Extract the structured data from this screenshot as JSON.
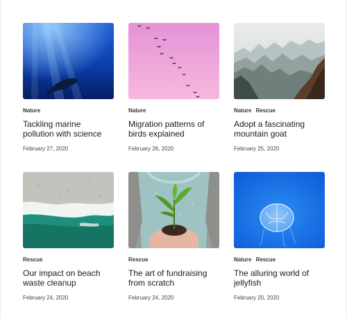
{
  "cards": [
    {
      "tags": [
        "Nature"
      ],
      "title": "Tackling marine pollution with science",
      "date": "February 27, 2020",
      "image": "whale-underwater-photo"
    },
    {
      "tags": [
        "Nature"
      ],
      "title": "Migration patterns of birds explained",
      "date": "February 26, 2020",
      "image": "birds-pink-sky-photo"
    },
    {
      "tags": [
        "Nature",
        "Rescue"
      ],
      "title": "Adopt a fascinating mountain goat",
      "date": "February 25, 2020",
      "image": "mountain-ridges-photo"
    },
    {
      "tags": [
        "Rescue"
      ],
      "title": "Our impact on beach waste cleanup",
      "date": "February 24, 2020",
      "image": "beach-waves-aerial-photo"
    },
    {
      "tags": [
        "Rescue"
      ],
      "title": "The art of fundraising from scratch",
      "date": "February 24, 2020",
      "image": "hands-holding-plant-photo"
    },
    {
      "tags": [
        "Nature",
        "Rescue"
      ],
      "title": "The alluring world of jellyfish",
      "date": "February 20, 2020",
      "image": "jellyfish-blue-photo"
    }
  ]
}
